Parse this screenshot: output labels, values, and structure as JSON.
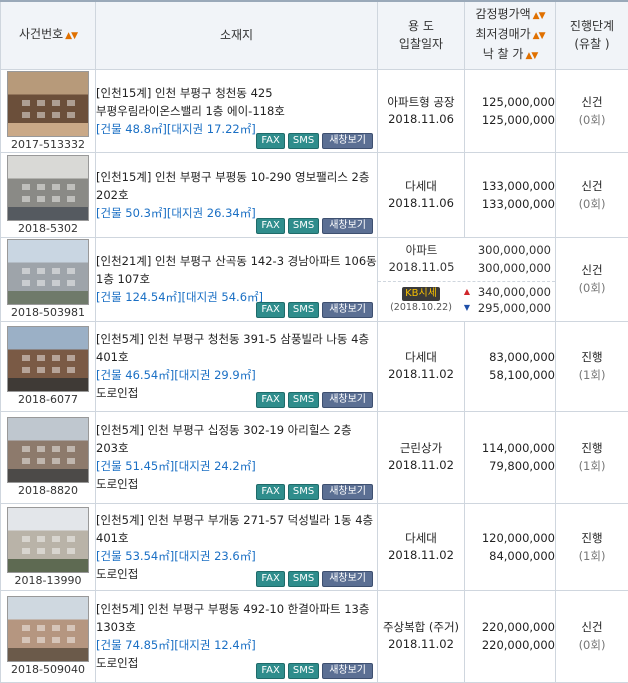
{
  "header": {
    "case_no": "사건번호",
    "location": "소재지",
    "use_line1": "용 도",
    "use_line2": "입찰일자",
    "price_line1": "감정평가액",
    "price_line2": "최저경매가",
    "price_line3": "낙 찰 가",
    "status_line1": "진행단계",
    "status_line2": "(유찰 )",
    "sort_glyph": "▲▼"
  },
  "buttons": {
    "fax": "FAX",
    "sms": "SMS",
    "new": "새창보기"
  },
  "market": {
    "badge": "KB시세",
    "date": "(2018.10.22)",
    "high": "340,000,000",
    "low": "295,000,000"
  },
  "rows": [
    {
      "case_no": "2017-513332",
      "address": "[인천15계] 인천 부평구 청천동 425 부평우림라이온스밸리 1층 에이-118호",
      "area": "[건물 48.8㎡][대지권 17.22㎡]",
      "road": "",
      "use": "아파트형 공장",
      "date": "2018.11.06",
      "appraisal": "125,000,000",
      "minimum": "125,000,000",
      "status": "신건",
      "count": "(0회)",
      "photo": [
        "#b79a7a",
        "#6b4f3a",
        "#caa987"
      ]
    },
    {
      "case_no": "2018-5302",
      "address": "[인천15계] 인천 부평구 부평동 10-290 영보팰리스 2층 202호",
      "area": "[건물 50.3㎡][대지권 26.34㎡]",
      "road": "",
      "use": "다세대",
      "date": "2018.11.06",
      "appraisal": "133,000,000",
      "minimum": "133,000,000",
      "status": "신건",
      "count": "(0회)",
      "photo": [
        "#d9d9d6",
        "#8a8a86",
        "#555a60"
      ]
    },
    {
      "case_no": "2018-503981",
      "address": "[인천21계] 인천 부평구 산곡동 142-3 경남아파트 106동 1층 107호",
      "area": "[건물 124.54㎡][대지권 54.6㎡]",
      "road": "",
      "use": "아파트",
      "date": "2018.11.05",
      "appraisal": "300,000,000",
      "minimum": "300,000,000",
      "status": "신건",
      "count": "(0회)",
      "photo": [
        "#c9d6e2",
        "#9ea4aa",
        "#6f7a6a"
      ]
    },
    {
      "case_no": "2018-6077",
      "address": "[인천5계] 인천 부평구 청천동 391-5 삼풍빌라 나동 4층 401호",
      "area": "[건물 46.54㎡][대지권 29.9㎡]",
      "road": "도로인접",
      "use": "다세대",
      "date": "2018.11.02",
      "appraisal": "83,000,000",
      "minimum": "58,100,000",
      "status": "진행",
      "count": "(1회)",
      "photo": [
        "#9bb0c6",
        "#7a5a45",
        "#3f3a36"
      ]
    },
    {
      "case_no": "2018-8820",
      "address": "[인천5계] 인천 부평구 십정동 302-19 아리힐스 2층 203호",
      "area": "[건물 51.45㎡][대지권 24.2㎡]",
      "road": "도로인접",
      "use": "근린상가",
      "date": "2018.11.02",
      "appraisal": "114,000,000",
      "minimum": "79,800,000",
      "status": "진행",
      "count": "(1회)",
      "photo": [
        "#bfc7cf",
        "#8d7a6c",
        "#4c4a48"
      ]
    },
    {
      "case_no": "2018-13990",
      "address": "[인천5계] 인천 부평구 부개동 271-57 덕성빌라 1동 4층 401호",
      "area": "[건물 53.54㎡][대지권 23.6㎡]",
      "road": "도로인접",
      "use": "다세대",
      "date": "2018.11.02",
      "appraisal": "120,000,000",
      "minimum": "84,000,000",
      "status": "진행",
      "count": "(1회)",
      "photo": [
        "#e3e6ea",
        "#b9b3a8",
        "#5e6a52"
      ]
    },
    {
      "case_no": "2018-509040",
      "address": "[인천5계] 인천 부평구 부평동 492-10 한결아파트 13층 1303호",
      "area": "[건물 74.85㎡][대지권 12.4㎡]",
      "road": "도로인접",
      "use": "주상복합 (주거)",
      "date": "2018.11.02",
      "appraisal": "220,000,000",
      "minimum": "220,000,000",
      "status": "신건",
      "count": "(0회)",
      "photo": [
        "#cfd8e0",
        "#b59680",
        "#6b5a4a"
      ]
    }
  ]
}
